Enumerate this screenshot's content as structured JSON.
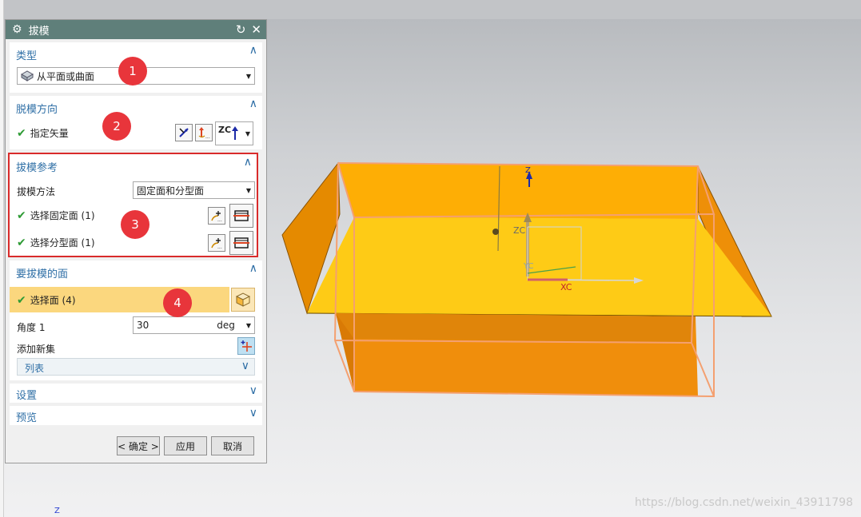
{
  "dialog": {
    "title": "拔模",
    "groups": {
      "type": {
        "header": "类型",
        "selected": "从平面或曲面"
      },
      "direction": {
        "header": "脱模方向",
        "specify_vector": "指定矢量",
        "vector_option": "ZC"
      },
      "reference": {
        "header": "拔模参考",
        "method_label": "拔模方法",
        "method_value": "固定面和分型面",
        "select_fixed": "选择固定面 (1)",
        "select_parting": "选择分型面 (1)"
      },
      "faces": {
        "header": "要拔模的面",
        "select_face": "选择面 (4)",
        "angle_label": "角度 1",
        "angle_value": "30",
        "angle_unit": "deg",
        "add_new_set": "添加新集",
        "list_label": "列表"
      },
      "settings": {
        "header": "设置"
      },
      "preview": {
        "header": "预览"
      }
    },
    "buttons": {
      "ok": "< 确定 >",
      "apply": "应用",
      "cancel": "取消"
    }
  },
  "badges": [
    "1",
    "2",
    "3",
    "4"
  ],
  "viewport": {
    "axis_labels": {
      "z": "Z",
      "zc": "ZC",
      "yc": "YC",
      "xc": "XC"
    },
    "corner_axis": "Z",
    "watermark": "https://blog.csdn.net/weixin_43911798"
  },
  "colors": {
    "title_bar": "#5f7f7a",
    "group_header": "#2f6fa6",
    "check": "#2e9b35",
    "badge": "#e8353b",
    "highlight_box": "#d92b2b",
    "selection_row": "#fbd77e",
    "model_front": "#fecb16",
    "model_side": "#ee8f08"
  }
}
